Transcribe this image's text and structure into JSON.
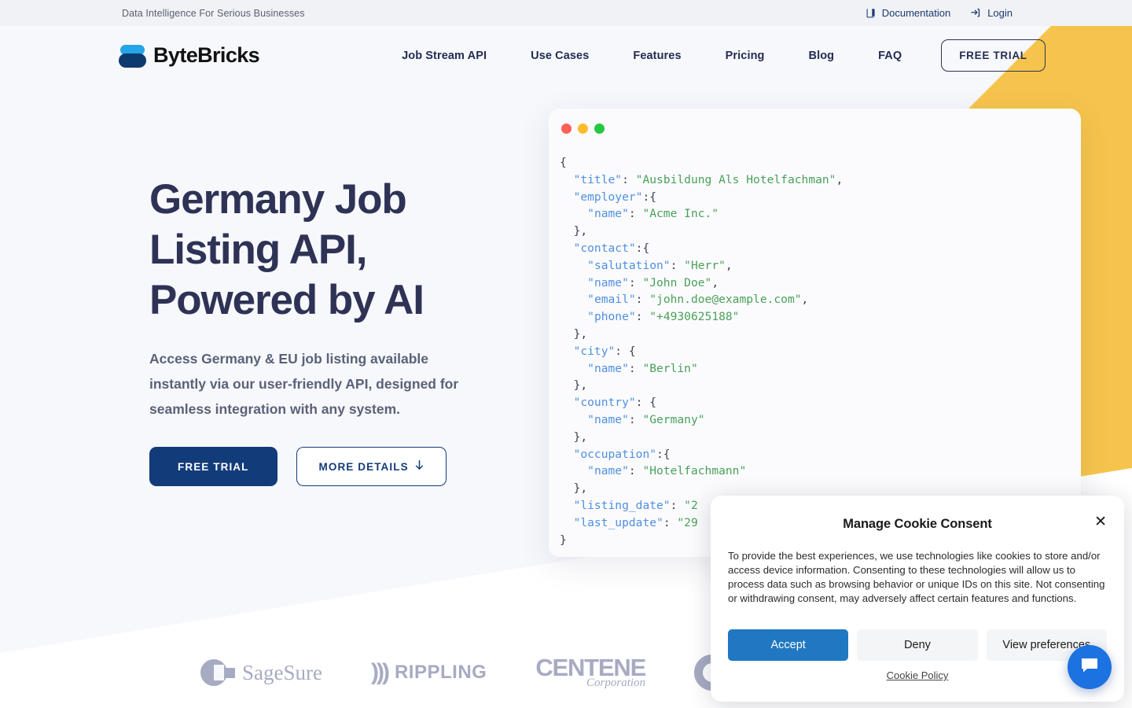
{
  "topbar": {
    "tagline": "Data Intelligence For Serious Businesses",
    "documentation": "Documentation",
    "login": "Login"
  },
  "brand": {
    "name": "ByteBricks"
  },
  "nav": {
    "items": [
      {
        "label": "Job Stream API"
      },
      {
        "label": "Use Cases"
      },
      {
        "label": "Features"
      },
      {
        "label": "Pricing"
      },
      {
        "label": "Blog"
      },
      {
        "label": "FAQ"
      }
    ],
    "cta": "FREE TRIAL"
  },
  "hero": {
    "title_line1": "Germany Job",
    "title_line2": "Listing API,",
    "title_line3": "Powered by AI",
    "subtitle": "Access Germany & EU job listing available instantly via our user-friendly API, designed for seamless integration with any system.",
    "primary_button": "FREE TRIAL",
    "secondary_button": "MORE DETAILS",
    "secondary_button_icon": "arrow-down-icon"
  },
  "code_panel": {
    "window_dots": [
      "red",
      "yellow",
      "green"
    ],
    "lines": [
      {
        "indent": 0,
        "parts": [
          {
            "t": "p",
            "v": "{"
          }
        ]
      },
      {
        "indent": 1,
        "parts": [
          {
            "t": "k",
            "v": "\"title\""
          },
          {
            "t": "p",
            "v": ": "
          },
          {
            "t": "s",
            "v": "\"Ausbildung Als Hotelfachman\""
          },
          {
            "t": "p",
            "v": ","
          }
        ]
      },
      {
        "indent": 1,
        "parts": [
          {
            "t": "k",
            "v": "\"employer\""
          },
          {
            "t": "p",
            "v": ":{"
          }
        ]
      },
      {
        "indent": 2,
        "parts": [
          {
            "t": "k",
            "v": "\"name\""
          },
          {
            "t": "p",
            "v": ": "
          },
          {
            "t": "s",
            "v": "\"Acme Inc.\""
          }
        ]
      },
      {
        "indent": 1,
        "parts": [
          {
            "t": "p",
            "v": "},"
          }
        ]
      },
      {
        "indent": 1,
        "parts": [
          {
            "t": "k",
            "v": "\"contact\""
          },
          {
            "t": "p",
            "v": ":{"
          }
        ]
      },
      {
        "indent": 2,
        "parts": [
          {
            "t": "k",
            "v": "\"salutation\""
          },
          {
            "t": "p",
            "v": ": "
          },
          {
            "t": "s",
            "v": "\"Herr\""
          },
          {
            "t": "p",
            "v": ","
          }
        ]
      },
      {
        "indent": 2,
        "parts": [
          {
            "t": "k",
            "v": "\"name\""
          },
          {
            "t": "p",
            "v": ": "
          },
          {
            "t": "s",
            "v": "\"John Doe\""
          },
          {
            "t": "p",
            "v": ","
          }
        ]
      },
      {
        "indent": 2,
        "parts": [
          {
            "t": "k",
            "v": "\"email\""
          },
          {
            "t": "p",
            "v": ": "
          },
          {
            "t": "s",
            "v": "\"john.doe@example.com\""
          },
          {
            "t": "p",
            "v": ","
          }
        ]
      },
      {
        "indent": 2,
        "parts": [
          {
            "t": "k",
            "v": "\"phone\""
          },
          {
            "t": "p",
            "v": ": "
          },
          {
            "t": "s",
            "v": "\"+4930625188\""
          }
        ]
      },
      {
        "indent": 1,
        "parts": [
          {
            "t": "p",
            "v": "},"
          }
        ]
      },
      {
        "indent": 1,
        "parts": [
          {
            "t": "k",
            "v": "\"city\""
          },
          {
            "t": "p",
            "v": ": {"
          }
        ]
      },
      {
        "indent": 2,
        "parts": [
          {
            "t": "k",
            "v": "\"name\""
          },
          {
            "t": "p",
            "v": ": "
          },
          {
            "t": "s",
            "v": "\"Berlin\""
          }
        ]
      },
      {
        "indent": 1,
        "parts": [
          {
            "t": "p",
            "v": "},"
          }
        ]
      },
      {
        "indent": 1,
        "parts": [
          {
            "t": "k",
            "v": "\"country\""
          },
          {
            "t": "p",
            "v": ": {"
          }
        ]
      },
      {
        "indent": 2,
        "parts": [
          {
            "t": "k",
            "v": "\"name\""
          },
          {
            "t": "p",
            "v": ": "
          },
          {
            "t": "s",
            "v": "\"Germany\""
          }
        ]
      },
      {
        "indent": 1,
        "parts": [
          {
            "t": "p",
            "v": "},"
          }
        ]
      },
      {
        "indent": 1,
        "parts": [
          {
            "t": "k",
            "v": "\"occupation\""
          },
          {
            "t": "p",
            "v": ":{"
          }
        ]
      },
      {
        "indent": 2,
        "parts": [
          {
            "t": "k",
            "v": "\"name\""
          },
          {
            "t": "p",
            "v": ": "
          },
          {
            "t": "s",
            "v": "\"Hotelfachmann\""
          }
        ]
      },
      {
        "indent": 1,
        "parts": [
          {
            "t": "p",
            "v": "},"
          }
        ]
      },
      {
        "indent": 1,
        "parts": [
          {
            "t": "k",
            "v": "\"listing_date\""
          },
          {
            "t": "p",
            "v": ": "
          },
          {
            "t": "s",
            "v": "\"2"
          }
        ]
      },
      {
        "indent": 1,
        "parts": [
          {
            "t": "k",
            "v": "\"last_update\""
          },
          {
            "t": "p",
            "v": ": "
          },
          {
            "t": "s",
            "v": "\"29"
          }
        ]
      },
      {
        "indent": 0,
        "parts": [
          {
            "t": "p",
            "v": "}"
          }
        ]
      }
    ]
  },
  "clients": [
    {
      "name": "SageSure"
    },
    {
      "name": "RIPPLING"
    },
    {
      "name": "CENTENE",
      "sub": "Corporation"
    },
    {
      "name": "ring-logo"
    }
  ],
  "cookie": {
    "title": "Manage Cookie Consent",
    "close_icon": "close-icon",
    "body": "To provide the best experiences, we use technologies like cookies to store and/or access device information. Consenting to these technologies will allow us to process data such as browsing behavior or unique IDs on this site. Not consenting or withdrawing consent, may adversely affect certain features and functions.",
    "accept": "Accept",
    "deny": "Deny",
    "preferences": "View preferences",
    "policy_link": "Cookie Policy"
  },
  "chat": {
    "icon": "chat-bubble-icon"
  },
  "colors": {
    "accent_yellow": "#f6c44c",
    "brand_navy": "#123c79",
    "brand_blue": "#25a5e8",
    "heading": "#2e3356",
    "page_bg": "#f7f8fc",
    "cookie_accept": "#1f78c1",
    "chat_blue": "#1b72e0"
  }
}
